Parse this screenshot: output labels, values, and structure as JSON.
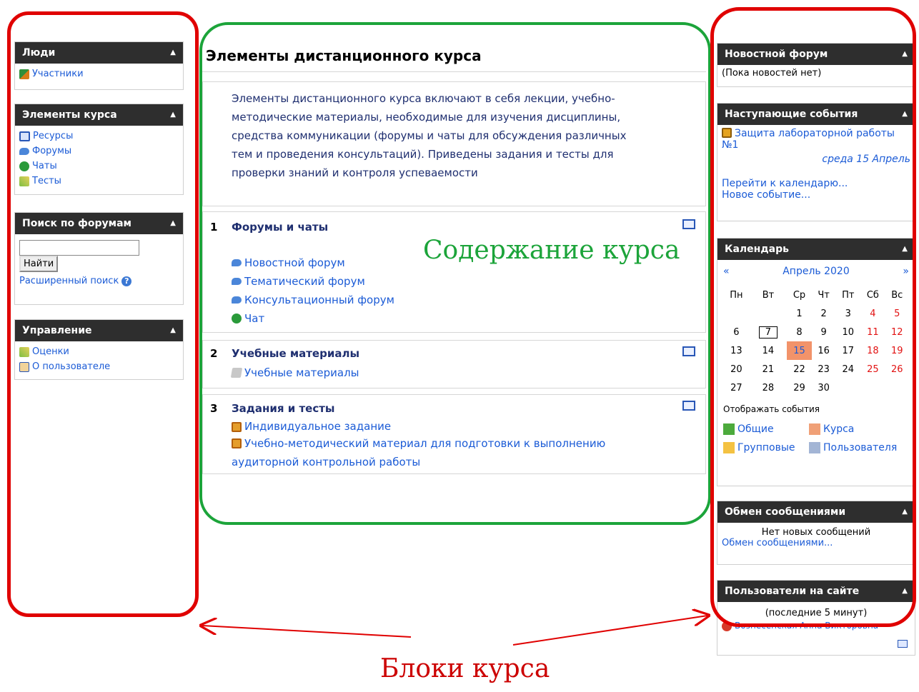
{
  "left": {
    "people": {
      "title": "Люди",
      "items": [
        "Участники"
      ]
    },
    "course_elements": {
      "title": "Элементы курса",
      "items": [
        "Ресурсы",
        "Форумы",
        "Чаты",
        "Тесты"
      ]
    },
    "forum_search": {
      "title": "Поиск по форумам",
      "button": "Найти",
      "advanced": "Расширенный поиск"
    },
    "admin": {
      "title": "Управление",
      "items": [
        "Оценки",
        "О пользователе"
      ]
    }
  },
  "center": {
    "title": "Элементы дистанционного курса",
    "intro": "Элементы дистанционного курса включают в себя лекции, учебно-методические материалы, необходимые для изучения дисциплины, средства коммуникации (форумы и чаты для обсуждения различных тем и проведения консультаций). Приведены задания и тесты для проверки знаний и контроля успеваемости",
    "sections": [
      {
        "num": "1",
        "title": "Форумы и чаты",
        "items": [
          "Новостной форум",
          "Тематический форум",
          "Консультационный форум",
          "Чат"
        ]
      },
      {
        "num": "2",
        "title": "Учебные материалы",
        "items": [
          "Учебные материалы"
        ]
      },
      {
        "num": "3",
        "title": "Задания и тесты",
        "items": [
          "Индивидуальное задание",
          "Учебно-методический материал для подготовки к выполнению аудиторной контрольной работы"
        ]
      }
    ]
  },
  "right": {
    "news": {
      "title": "Новостной форум",
      "text": "(Пока новостей нет)"
    },
    "upcoming": {
      "title": "Наступающие события",
      "event": "Защита лабораторной работы №1",
      "date": "среда 15 Апрель",
      "goto": "Перейти к календарю...",
      "new_event": "Новое событие..."
    },
    "calendar": {
      "title": "Календарь",
      "prev": "«",
      "next": "»",
      "month": "Апрель 2020",
      "days": [
        "Пн",
        "Вт",
        "Ср",
        "Чт",
        "Пт",
        "Сб",
        "Вс"
      ],
      "weeks": [
        [
          "",
          "",
          "1",
          "2",
          "3",
          "4",
          "5"
        ],
        [
          "6",
          "7",
          "8",
          "9",
          "10",
          "11",
          "12"
        ],
        [
          "13",
          "14",
          "15",
          "16",
          "17",
          "18",
          "19"
        ],
        [
          "20",
          "21",
          "22",
          "23",
          "24",
          "25",
          "26"
        ],
        [
          "27",
          "28",
          "29",
          "30",
          "",
          "",
          ""
        ]
      ],
      "show_events": "Отображать события",
      "legend": [
        "Общие",
        "Курса",
        "Групповые",
        "Пользователя"
      ]
    },
    "messages": {
      "title": "Обмен сообщениями",
      "none": "Нет новых сообщений",
      "link": "Обмен сообщениями..."
    },
    "online": {
      "title": "Пользователи на сайте",
      "subtitle": "(последние 5 минут)",
      "user": "Вознесенская Анна Викторовна"
    }
  },
  "annotations": {
    "content": "Содержание курса",
    "blocks": "Блоки курса"
  },
  "colors": {
    "red": "#e00000",
    "green": "#1ca43a",
    "header": "#2e2e2e",
    "link": "#1b5bd6"
  }
}
